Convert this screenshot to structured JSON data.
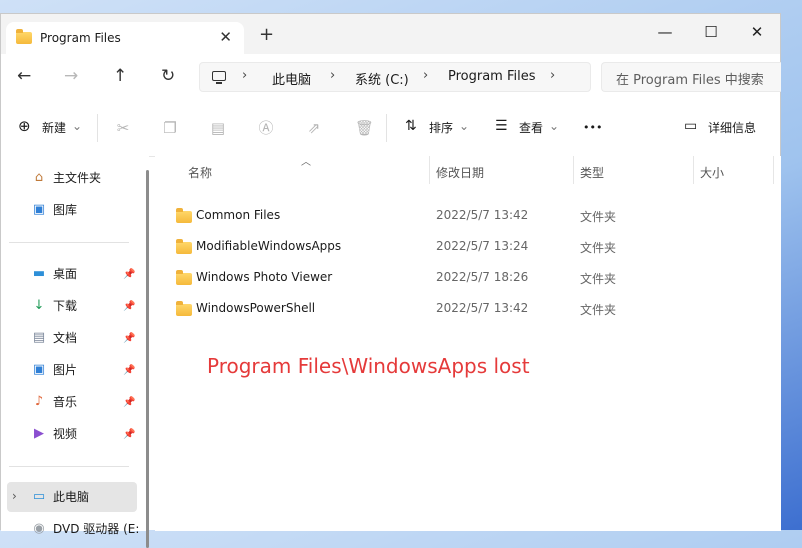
{
  "window": {
    "tab_title": "Program Files",
    "new_tab": "+",
    "tab_close": "✕",
    "controls": {
      "minimize": "—",
      "maximize": "☐",
      "close": "✕"
    }
  },
  "nav": {
    "back": "←",
    "forward": "→",
    "up": "↑",
    "refresh": "↻"
  },
  "breadcrumb": [
    "此电脑",
    "系统 (C:)",
    "Program Files"
  ],
  "breadcrumb_sep": "›",
  "search": {
    "placeholder": "在 Program Files 中搜索"
  },
  "toolbar": {
    "new_label": "新建",
    "sort_label": "排序",
    "view_label": "查看",
    "more": "•••",
    "details_label": "详细信息",
    "dropdown": "⌄",
    "disabled_icons": [
      "cut-icon",
      "copy-icon",
      "paste-icon",
      "rename-icon",
      "share-icon",
      "delete-icon"
    ]
  },
  "sidebar": {
    "top_items": [
      {
        "label": "主文件夹",
        "icon": "home-icon"
      },
      {
        "label": "图库",
        "icon": "gallery-icon"
      }
    ],
    "quick_items": [
      {
        "label": "桌面",
        "icon": "desktop-icon"
      },
      {
        "label": "下载",
        "icon": "download-icon"
      },
      {
        "label": "文档",
        "icon": "documents-icon"
      },
      {
        "label": "图片",
        "icon": "pictures-icon"
      },
      {
        "label": "音乐",
        "icon": "music-icon"
      },
      {
        "label": "视频",
        "icon": "videos-icon"
      }
    ],
    "this_pc": "此电脑",
    "dvd": "DVD 驱动器 (E:"
  },
  "columns": {
    "name": "名称",
    "date": "修改日期",
    "type": "类型",
    "size": "大小"
  },
  "files": [
    {
      "name": "Common Files",
      "date": "2022/5/7 13:42",
      "type": "文件夹"
    },
    {
      "name": "ModifiableWindowsApps",
      "date": "2022/5/7 13:24",
      "type": "文件夹"
    },
    {
      "name": "Windows Photo Viewer",
      "date": "2022/5/7 18:26",
      "type": "文件夹"
    },
    {
      "name": "WindowsPowerShell",
      "date": "2022/5/7 13:42",
      "type": "文件夹"
    }
  ],
  "annotation": "Program Files\\WindowsApps lost",
  "colors": {
    "annotation": "#e53a3a",
    "folder": "#f5b93b",
    "selection": "#e5e5e5"
  }
}
